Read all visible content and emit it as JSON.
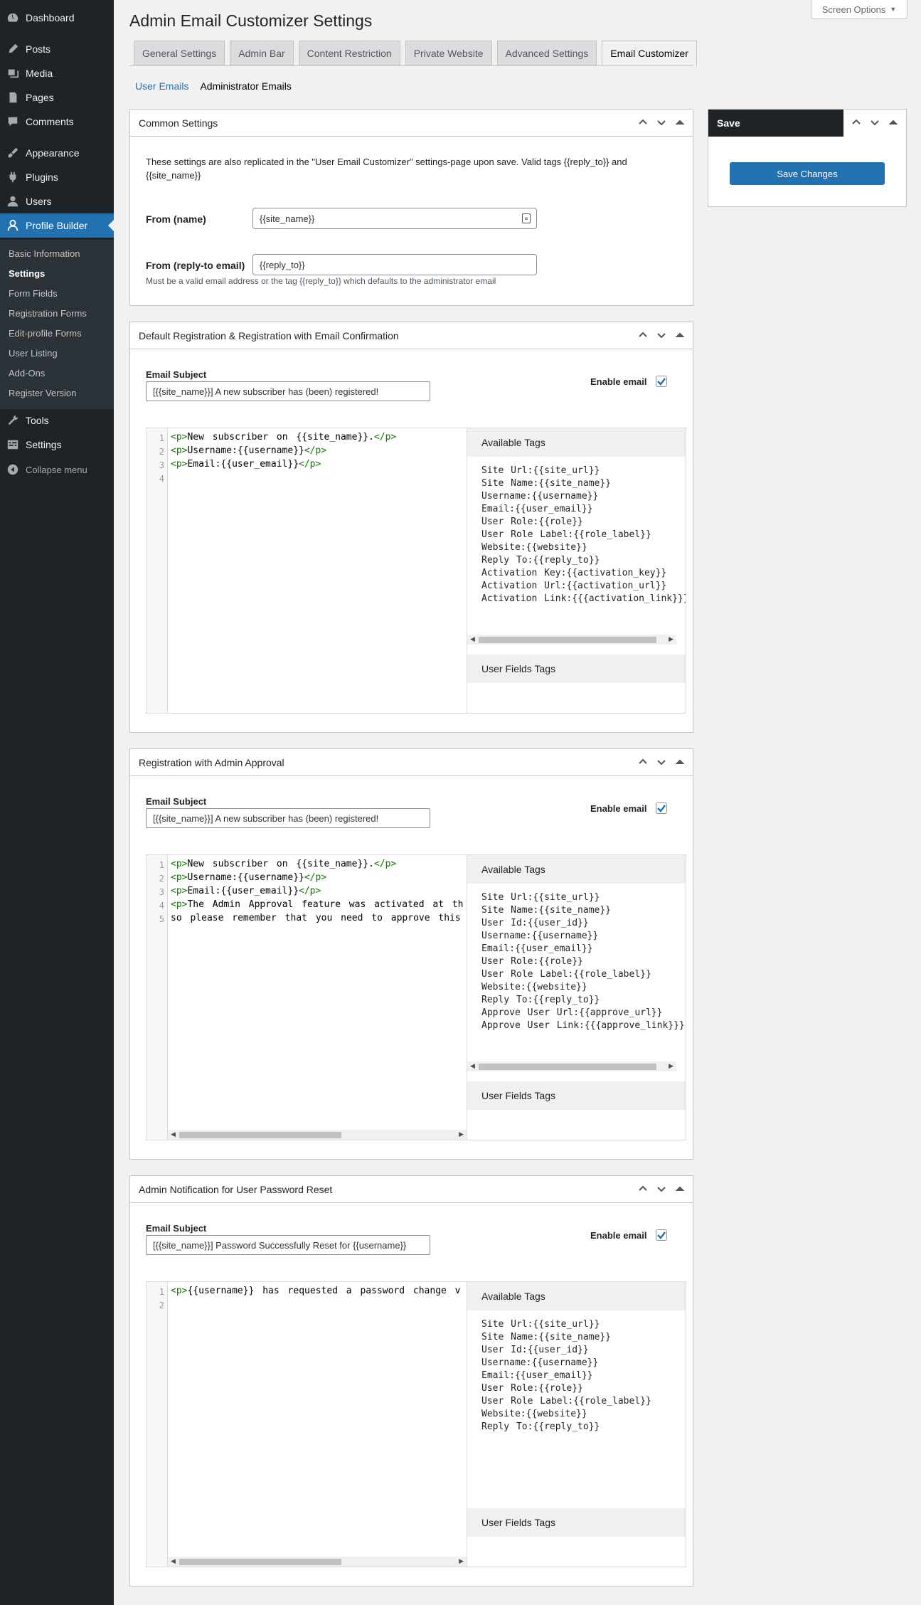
{
  "sidebar": {
    "items": [
      {
        "label": "Dashboard",
        "icon": "dashboard-icon"
      },
      {
        "label": "Posts",
        "icon": "posts-icon"
      },
      {
        "label": "Media",
        "icon": "media-icon"
      },
      {
        "label": "Pages",
        "icon": "pages-icon"
      },
      {
        "label": "Comments",
        "icon": "comments-icon"
      },
      {
        "label": "Appearance",
        "icon": "appearance-icon"
      },
      {
        "label": "Plugins",
        "icon": "plugins-icon"
      },
      {
        "label": "Users",
        "icon": "users-icon"
      },
      {
        "label": "Profile Builder",
        "icon": "profile-builder-icon"
      },
      {
        "label": "Tools",
        "icon": "tools-icon"
      },
      {
        "label": "Settings",
        "icon": "settings-icon"
      }
    ],
    "submenu": [
      "Basic Information",
      "Settings",
      "Form Fields",
      "Registration Forms",
      "Edit-profile Forms",
      "User Listing",
      "Add-Ons",
      "Register Version"
    ],
    "collapse_label": "Collapse menu"
  },
  "header": {
    "title": "Admin Email Customizer Settings",
    "screen_options": "Screen Options"
  },
  "tabs": [
    "General Settings",
    "Admin Bar",
    "Content Restriction",
    "Private Website",
    "Advanced Settings",
    "Email Customizer"
  ],
  "subtabs": {
    "user_emails": "User Emails",
    "admin_emails": "Administrator Emails"
  },
  "common": {
    "title": "Common Settings",
    "note": "These settings are also replicated in the \"User Email Customizer\" settings-page upon save. Valid tags {{reply_to}} and {{site_name}}",
    "from_name_label": "From (name)",
    "from_name_value": "{{site_name}}",
    "reply_label": "From (reply-to email)",
    "reply_value": "{{reply_to}}",
    "reply_desc": "Must be a valid email address or the tag {{reply_to}} which defaults to the administrator email"
  },
  "labels": {
    "email_subject": "Email Subject",
    "enable_email": "Enable email",
    "available_tags": "Available Tags",
    "user_fields_tags": "User Fields Tags"
  },
  "sections": [
    {
      "title": "Default Registration & Registration with Email Confirmation",
      "subject": "[{{site_name}}] A new subscriber has (been) registered!",
      "enabled": true,
      "code_lines": [
        [
          [
            "t",
            "<p>"
          ],
          [
            "x",
            "New subscriber on {{site_name}}."
          ],
          [
            "t",
            "</p>"
          ]
        ],
        [
          [
            "t",
            "<p>"
          ],
          [
            "x",
            "Username:{{username}}"
          ],
          [
            "t",
            "</p>"
          ]
        ],
        [
          [
            "t",
            "<p>"
          ],
          [
            "x",
            "Email:{{user_email}}"
          ],
          [
            "t",
            "</p>"
          ]
        ],
        []
      ],
      "tags": [
        "Site Url:{{site_url}}",
        "Site Name:{{site_name}}",
        "Username:{{username}}",
        "Email:{{user_email}}",
        "User Role:{{role}}",
        "User Role Label:{{role_label}}",
        "Website:{{website}}",
        "Reply To:{{reply_to}}",
        "Activation Key:{{activation_key}}",
        "Activation Url:{{activation_url}}",
        "Activation Link:{{{activation_link}}}"
      ]
    },
    {
      "title": "Registration with Admin Approval",
      "subject": "[{{site_name}}] A new subscriber has (been) registered!",
      "enabled": true,
      "code_lines": [
        [
          [
            "t",
            "<p>"
          ],
          [
            "x",
            "New subscriber on {{site_name}}."
          ],
          [
            "t",
            "</p>"
          ]
        ],
        [
          [
            "t",
            "<p>"
          ],
          [
            "x",
            "Username:{{username}}"
          ],
          [
            "t",
            "</p>"
          ]
        ],
        [
          [
            "t",
            "<p>"
          ],
          [
            "x",
            "Email:{{user_email}}"
          ],
          [
            "t",
            "</p>"
          ]
        ],
        [
          [
            "t",
            "<p>"
          ],
          [
            "x",
            "The Admin Approval feature was activated at th"
          ]
        ],
        [
          [
            "x",
            "so please remember that you need to approve this"
          ]
        ]
      ],
      "tags": [
        "Site Url:{{site_url}}",
        "Site Name:{{site_name}}",
        "User Id:{{user_id}}",
        "Username:{{username}}",
        "Email:{{user_email}}",
        "User Role:{{role}}",
        "User Role Label:{{role_label}}",
        "Website:{{website}}",
        "Reply To:{{reply_to}}",
        "Approve User Url:{{approve_url}}",
        "Approve User Link:{{{approve_link}}}"
      ]
    },
    {
      "title": "Admin Notification for User Password Reset",
      "subject": "[{{site_name}}] Password Successfully Reset for {{username}}",
      "enabled": true,
      "code_lines": [
        [
          [
            "t",
            "<p>"
          ],
          [
            "x",
            "{{username}} has requested a password change v"
          ]
        ],
        []
      ],
      "tags": [
        "Site Url:{{site_url}}",
        "Site Name:{{site_name}}",
        "User Id:{{user_id}}",
        "Username:{{username}}",
        "Email:{{user_email}}",
        "User Role:{{role}}",
        "User Role Label:{{role_label}}",
        "Website:{{website}}",
        "Reply To:{{reply_to}}"
      ]
    }
  ],
  "save": {
    "title": "Save",
    "button": "Save Changes"
  }
}
